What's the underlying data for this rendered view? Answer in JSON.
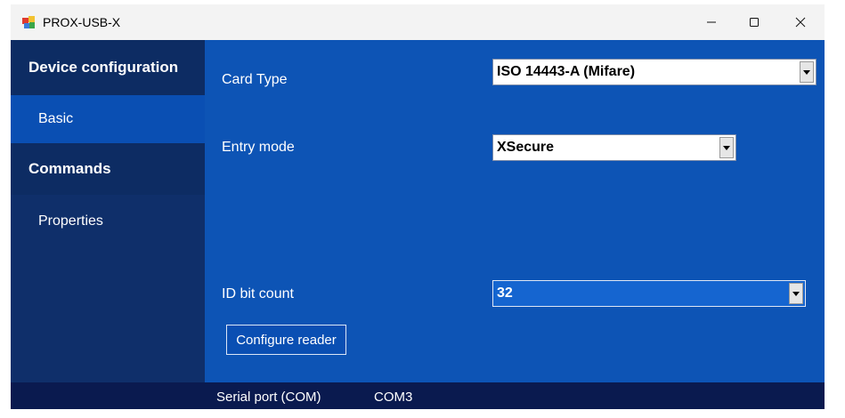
{
  "window": {
    "title": "PROX-USB-X",
    "icon": "app-icon"
  },
  "titlebar_buttons": {
    "minimize_icon": "minimize-icon",
    "maximize_icon": "maximize-icon",
    "close_icon": "close-icon"
  },
  "sidebar": {
    "items": [
      {
        "label": "Device configuration",
        "kind": "header"
      },
      {
        "label": "Basic",
        "kind": "sub",
        "selected": true
      },
      {
        "label": "Commands",
        "kind": "header"
      },
      {
        "label": "Properties",
        "kind": "sub"
      }
    ]
  },
  "main": {
    "card_type": {
      "label": "Card Type",
      "value": "ISO 14443-A (Mifare)"
    },
    "entry_mode": {
      "label": "Entry mode",
      "value": "XSecure"
    },
    "id_bit_count": {
      "label": "ID bit count",
      "value": "32"
    },
    "configure_button": "Configure reader"
  },
  "status": {
    "label": "Serial port (COM)",
    "value": "COM3"
  },
  "colors": {
    "sidebar": "#0f2f6a",
    "selected": "#0a4fb3",
    "main": "#0d54b5",
    "status": "#0a1a4f"
  }
}
